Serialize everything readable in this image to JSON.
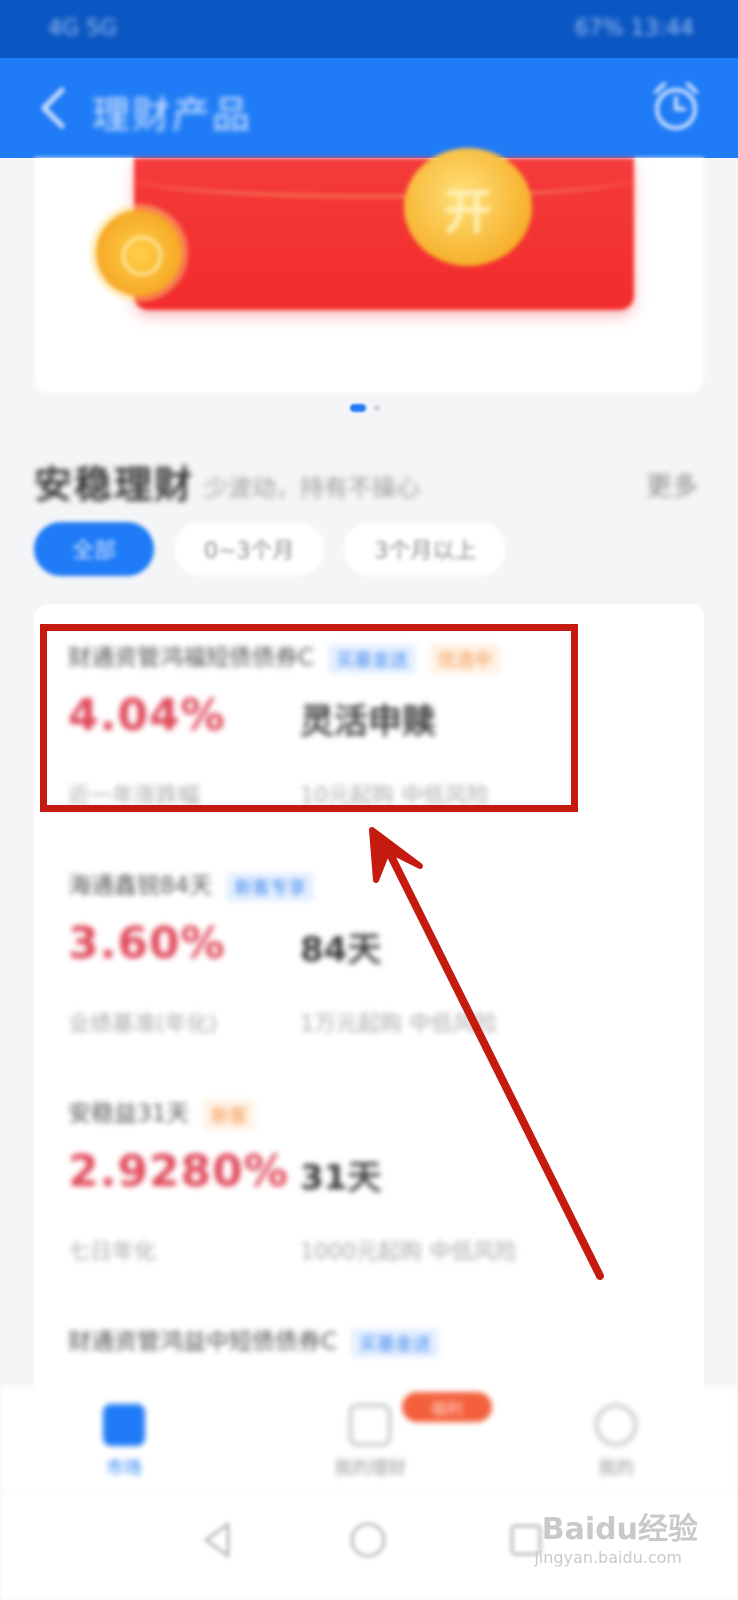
{
  "status_bar": {
    "left": "4G 5G",
    "right": "67% 13:44"
  },
  "header": {
    "title": "理财产品",
    "back_icon": "chevron-left-icon",
    "alarm_icon": "alarm-clock-icon"
  },
  "banner": {
    "coin_text": "开"
  },
  "section": {
    "title": "安稳理财",
    "subtitle": "少波动，持有不操心",
    "more": "更多",
    "tabs": [
      {
        "label": "全部",
        "active": true
      },
      {
        "label": "0~3个月",
        "active": false
      },
      {
        "label": "3个月以上",
        "active": false
      }
    ]
  },
  "products": [
    {
      "name": "财通资管鸿福短债债券C",
      "tags": [
        {
          "text": "买基金送",
          "style": "blue"
        },
        {
          "text": "优选中",
          "style": "orange"
        }
      ],
      "rate": "4.04%",
      "rate_label": "近一年涨跌幅",
      "term": "灵活申赎",
      "desc": "10元起购 中低风险"
    },
    {
      "name": "海通鑫锐84天",
      "tags": [
        {
          "text": "新客专享",
          "style": "blue"
        }
      ],
      "rate": "3.60%",
      "rate_label": "业绩基准(年化)",
      "term": "84天",
      "desc": "1万元起购 中低风险"
    },
    {
      "name": "安稳益31天",
      "tags": [
        {
          "text": "新客",
          "style": "orange"
        }
      ],
      "rate": "2.9280%",
      "rate_label": "七日年化",
      "term": "31天",
      "desc": "1000元起购 中低风险"
    },
    {
      "name": "财通资管鸿益中短债债券C",
      "tags": [
        {
          "text": "买基金送",
          "style": "blue"
        }
      ],
      "rate": "",
      "rate_label": "",
      "term": "",
      "desc": ""
    }
  ],
  "bottom_nav": {
    "items": [
      {
        "label": "市场",
        "icon": "market-icon",
        "active": true
      },
      {
        "label": "我的理财",
        "icon": "portfolio-icon",
        "active": false
      },
      {
        "label": "我的",
        "icon": "profile-icon",
        "active": false
      }
    ],
    "badge": "福利"
  },
  "watermark": {
    "brand": "Baidu经验",
    "url": "jingyan.baidu.com"
  },
  "colors": {
    "primary": "#1f7cf6",
    "rate_red": "#e0485a",
    "annotation": "#c51a10"
  }
}
